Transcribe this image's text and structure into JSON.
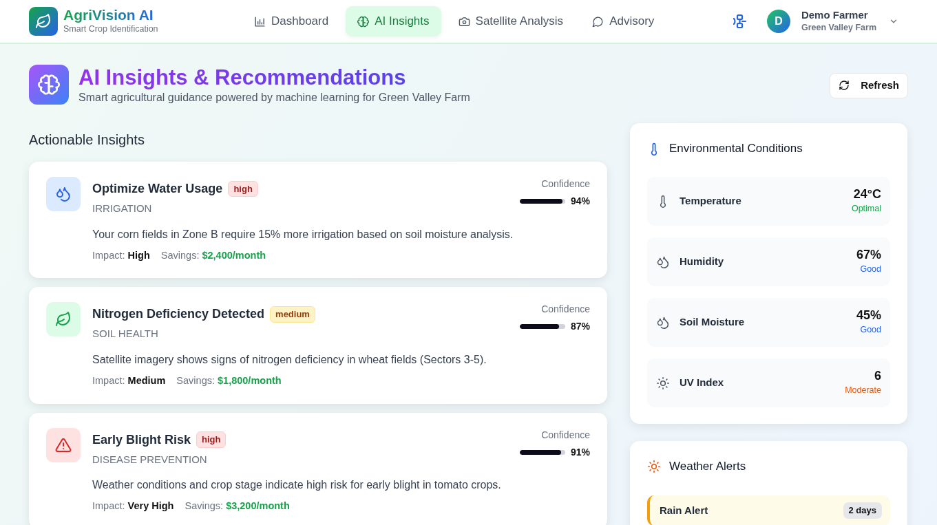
{
  "brand": {
    "name": "AgriVision AI",
    "tagline": "Smart Crop Identification"
  },
  "nav": [
    {
      "label": "Dashboard",
      "kind": "chart",
      "selected": false
    },
    {
      "label": "AI Insights",
      "kind": "brain",
      "selected": true
    },
    {
      "label": "Satellite Analysis",
      "kind": "camera",
      "selected": false
    },
    {
      "label": "Advisory",
      "kind": "chat",
      "selected": false
    }
  ],
  "user": {
    "initial": "D",
    "name": "Demo Farmer",
    "farm": "Green Valley Farm"
  },
  "header": {
    "title": "AI Insights & Recommendations",
    "subtitle": "Smart agricultural guidance powered by machine learning for Green Valley Farm",
    "refresh": "Refresh"
  },
  "insights_title": "Actionable Insights",
  "insights": [
    {
      "kind": "water",
      "title": "Optimize Water Usage",
      "priority": {
        "label": "high",
        "kind": "high"
      },
      "category": "IRRIGATION",
      "confidence_label": "Confidence",
      "level": 0.94,
      "confidence": "94%",
      "description": "Your corn fields in Zone B require 15% more irrigation based on soil moisture analysis.",
      "impact_label": "Impact:",
      "impact": "High",
      "savings_label": "Savings:",
      "savings": "$2,400/month"
    },
    {
      "kind": "leaf",
      "title": "Nitrogen Deficiency Detected",
      "priority": {
        "label": "medium",
        "kind": "medium"
      },
      "category": "SOIL HEALTH",
      "confidence_label": "Confidence",
      "level": 0.87,
      "confidence": "87%",
      "description": "Satellite imagery shows signs of nitrogen deficiency in wheat fields (Sectors 3-5).",
      "impact_label": "Impact:",
      "impact": "Medium",
      "savings_label": "Savings:",
      "savings": "$1,800/month"
    },
    {
      "kind": "warning",
      "title": "Early Blight Risk",
      "priority": {
        "label": "high",
        "kind": "high"
      },
      "category": "DISEASE PREVENTION",
      "confidence_label": "Confidence",
      "level": 0.91,
      "confidence": "91%",
      "description": "Weather conditions and crop stage indicate high risk for early blight in tomato crops.",
      "impact_label": "Impact:",
      "impact": "Very High",
      "savings_label": "Savings:",
      "savings": "$3,200/month"
    }
  ],
  "environment": {
    "title": "Environmental Conditions",
    "items": [
      {
        "kind": "thermometer",
        "label": "Temperature",
        "value": "24°C",
        "status": "Optimal",
        "color": "#16a34a"
      },
      {
        "kind": "droplets",
        "label": "Humidity",
        "value": "67%",
        "status": "Good",
        "color": "#2563eb"
      },
      {
        "kind": "droplets",
        "label": "Soil Moisture",
        "value": "45%",
        "status": "Good",
        "color": "#2563eb"
      },
      {
        "kind": "sun",
        "label": "UV Index",
        "value": "6",
        "status": "Moderate",
        "color": "#ea580c"
      }
    ]
  },
  "weather_alerts": {
    "title": "Weather Alerts",
    "items": [
      {
        "title": "Rain Alert",
        "when": "2 days"
      }
    ]
  }
}
